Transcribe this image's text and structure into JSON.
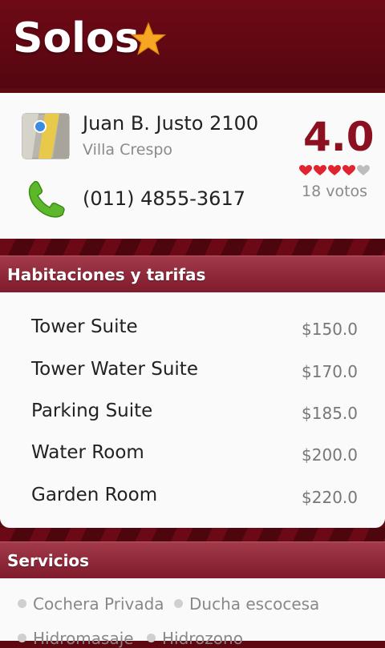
{
  "header": {
    "title": "Solos"
  },
  "place": {
    "address": "Juan B. Justo 2100",
    "neighborhood": "Villa Crespo",
    "phone": "(011) 4855-3617",
    "rating": "4.0",
    "rating_value": 4,
    "rating_max": 5,
    "votes": "18 votos"
  },
  "rooms_section": {
    "title": "Habitaciones y tarifas",
    "items": [
      {
        "name": "Tower Suite",
        "price": "$150.0"
      },
      {
        "name": "Tower Water Suite",
        "price": "$170.0"
      },
      {
        "name": "Parking Suite",
        "price": "$185.0"
      },
      {
        "name": "Water Room",
        "price": "$200.0"
      },
      {
        "name": "Garden Room",
        "price": "$220.0"
      }
    ]
  },
  "services_section": {
    "title": "Servicios",
    "items": [
      "Cochera Privada",
      "Ducha escocesa",
      "Hidromasaje",
      "Hidrozono"
    ]
  },
  "colors": {
    "brand": "#6e0a16",
    "rating_text": "#8b1020",
    "heart_on": "#e0232e",
    "heart_off": "#bdbdbd"
  },
  "icons": [
    "star-icon",
    "map-icon",
    "phone-icon",
    "heart-icon"
  ]
}
